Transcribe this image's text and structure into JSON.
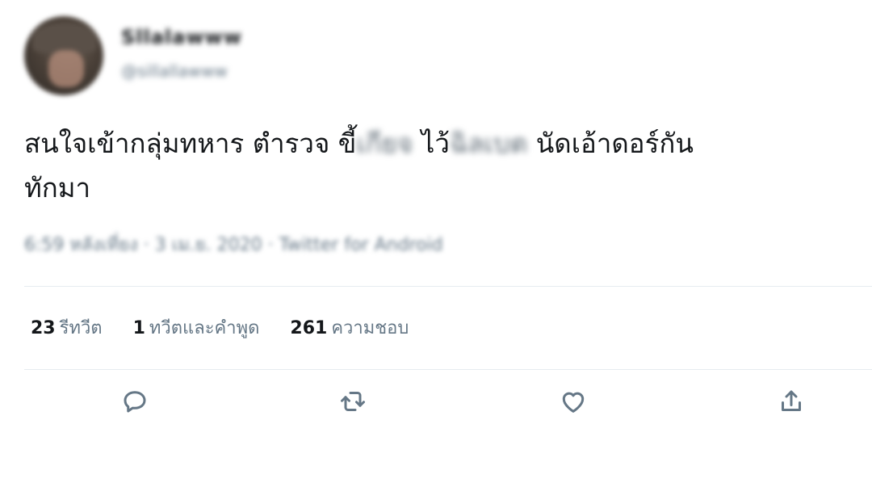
{
  "user": {
    "display_name": "Sllalawww",
    "handle": "@sillallawww"
  },
  "tweet": {
    "text_1": "สนใจเข้ากลุ่มทหาร ตำรวจ ขี้",
    "text_blur_1": "เกียจ",
    "text_2": " ไว้",
    "text_blur_2": "ฉิลเบต",
    "text_3": " นัดเอ้าดอร์กัน",
    "text_4": "ทักมา"
  },
  "meta": {
    "timestamp": "6:59 หลังเที่ยง · 3 เม.ย. 2020 · Twitter for Android"
  },
  "stats": {
    "retweets_count": "23",
    "retweets_label": "รีทวีต",
    "quotes_count": "1",
    "quotes_label": "ทวีตและคำพูด",
    "likes_count": "261",
    "likes_label": "ความชอบ"
  },
  "actions": {
    "icons": [
      "reply-icon",
      "retweet-icon",
      "like-icon",
      "share-icon"
    ]
  },
  "colors": {
    "text": "#14171a",
    "secondary": "#657786",
    "divider": "#e6ecf0"
  }
}
